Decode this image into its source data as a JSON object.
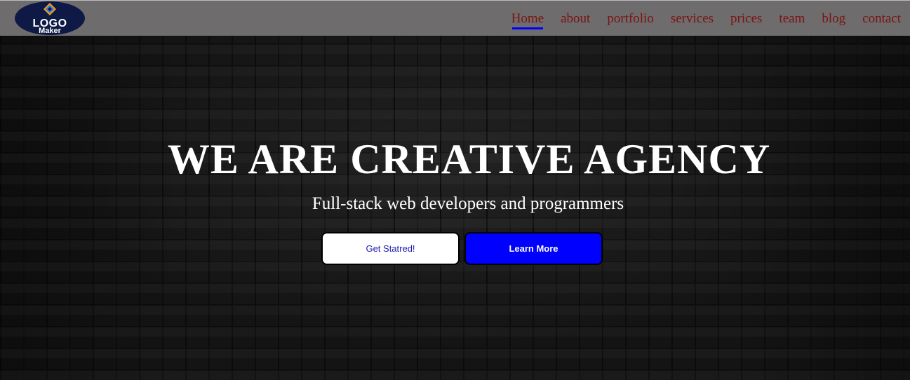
{
  "logo": {
    "text_main": "LOGO",
    "text_sub": "Maker",
    "icon": "diamond-logo-icon"
  },
  "nav": {
    "items": [
      {
        "label": "Home",
        "active": true
      },
      {
        "label": "about"
      },
      {
        "label": "portfolio"
      },
      {
        "label": "services"
      },
      {
        "label": "prices"
      },
      {
        "label": "team"
      },
      {
        "label": "blog"
      },
      {
        "label": "contact"
      }
    ]
  },
  "hero": {
    "title": "WE ARE CREATIVE AGENCY",
    "subtitle": "Full-stack web developers and programmers",
    "primary_button": "Get Statred!",
    "secondary_button": "Learn More"
  },
  "colors": {
    "navbar_bg": "#6e6c6c",
    "nav_link": "#7c1313",
    "active_underline": "#0000ff",
    "learn_more_bg": "#0000ff",
    "logo_bg": "#0e1a45"
  }
}
